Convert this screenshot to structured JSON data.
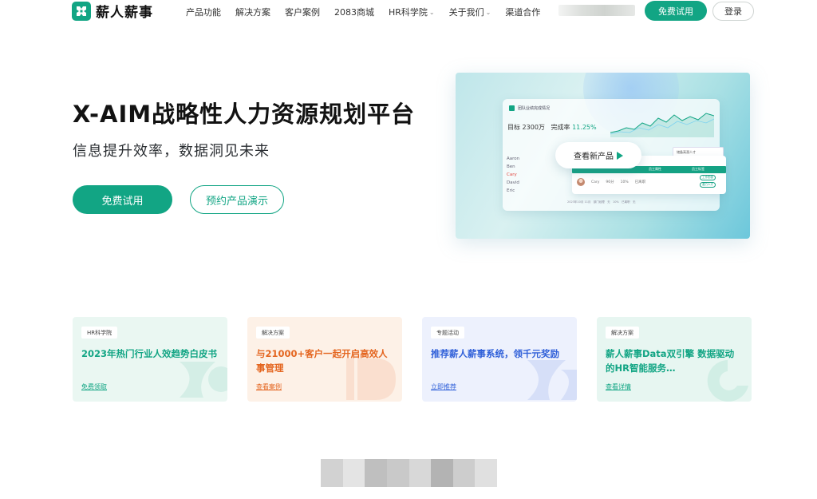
{
  "brand": {
    "name": "薪人薪事",
    "accent": "#12a584"
  },
  "nav": {
    "items": [
      {
        "label": "产品功能",
        "dropdown": false
      },
      {
        "label": "解决方案",
        "dropdown": false
      },
      {
        "label": "客户案例",
        "dropdown": false
      },
      {
        "label": "2083商城",
        "dropdown": false
      },
      {
        "label": "HR科学院",
        "dropdown": true
      },
      {
        "label": "关于我们",
        "dropdown": true
      },
      {
        "label": "渠道合作",
        "dropdown": false
      }
    ],
    "trial_label": "免费试用",
    "login_label": "登录"
  },
  "hero": {
    "title": "X-AIM战略性人力资源规划平台",
    "subtitle": "信息提升效率，数据洞见未来",
    "trial_label": "免费试用",
    "demo_label": "预约产品演示",
    "preview": {
      "card_title": "团队业绩完成情况",
      "target_label": "目标",
      "target_value": "2300万",
      "rate_label": "完成率",
      "rate_value": "11.25%",
      "names": [
        "Aaron",
        "Ben",
        "Cary",
        "David",
        "Eric"
      ],
      "highlight_name": "Cary",
      "play_label": "查看新产品",
      "search_text": "储备高潜人才",
      "table_headers": [
        "员工属性",
        "员工标签"
      ],
      "row_name": "Cary",
      "row_values": [
        "96分",
        "10%",
        "已离职"
      ],
      "tags": [
        "工作勤奋",
        "潜力人才",
        "工作积极",
        "团队合作"
      ],
      "bottom_row": [
        "2023年10月 11月",
        "部门经理",
        "无",
        "10%",
        "已离职",
        "无"
      ]
    }
  },
  "cards": [
    {
      "badge": "HR科学院",
      "title": "2023年热门行业人效趋势白皮书",
      "link": "免费领取",
      "color": "#12a584"
    },
    {
      "badge": "解决方案",
      "title": "与21000+客户一起开启高效人事管理",
      "link": "查看案例",
      "color": "#e4651f"
    },
    {
      "badge": "专题活动",
      "title": "推荐薪人薪事系统，领千元奖励",
      "link": "立即推荐",
      "color": "#3161d9"
    },
    {
      "badge": "解决方案",
      "title": "薪人薪事Data双引擎 数据驱动的HR智能服务…",
      "link": "查看详情",
      "color": "#12a584"
    }
  ]
}
